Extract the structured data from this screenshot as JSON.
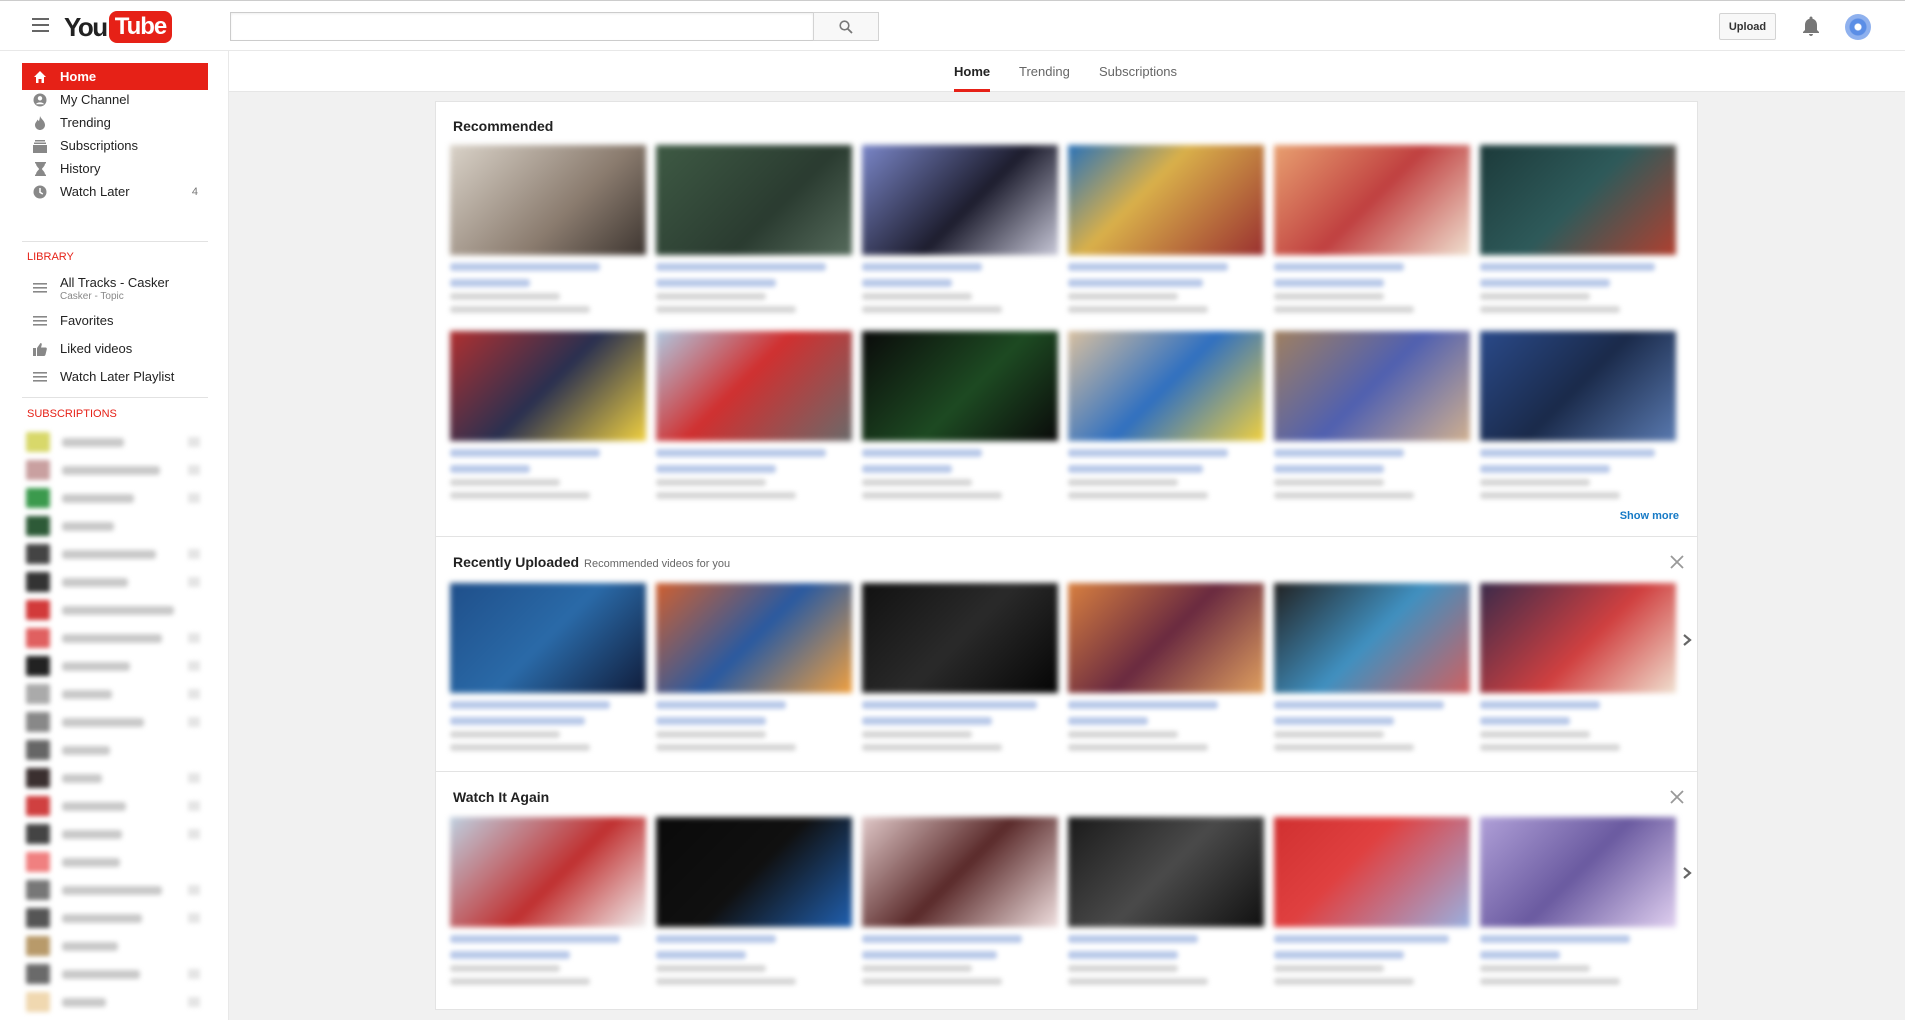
{
  "header": {
    "logo_you": "You",
    "logo_tube": "Tube",
    "search_placeholder": "",
    "upload_label": "Upload"
  },
  "sidebar": {
    "nav": [
      {
        "label": "Home",
        "icon": "home-icon"
      },
      {
        "label": "My Channel",
        "icon": "account-icon"
      },
      {
        "label": "Trending",
        "icon": "flame-icon"
      },
      {
        "label": "Subscriptions",
        "icon": "subscriptions-icon"
      },
      {
        "label": "History",
        "icon": "hourglass-icon"
      },
      {
        "label": "Watch Later",
        "icon": "clock-icon",
        "count": "4"
      }
    ],
    "library_label": "LIBRARY",
    "library": [
      {
        "label": "All Tracks - Casker",
        "sub": "Casker - Topic"
      },
      {
        "label": "Favorites"
      },
      {
        "label": "Liked videos"
      },
      {
        "label": "Watch Later Playlist"
      }
    ],
    "subscriptions_label": "SUBSCRIPTIONS"
  },
  "tabs": [
    "Home",
    "Trending",
    "Subscriptions"
  ],
  "shelves": {
    "recommended": {
      "title": "Recommended",
      "show_more": "Show more"
    },
    "recently_uploaded": {
      "title": "Recently Uploaded",
      "subtitle": "Recommended videos for you"
    },
    "watch_it_again": {
      "title": "Watch It Again"
    }
  },
  "colors": {
    "brand_red": "#e62117",
    "link_blue": "#167ac6"
  }
}
